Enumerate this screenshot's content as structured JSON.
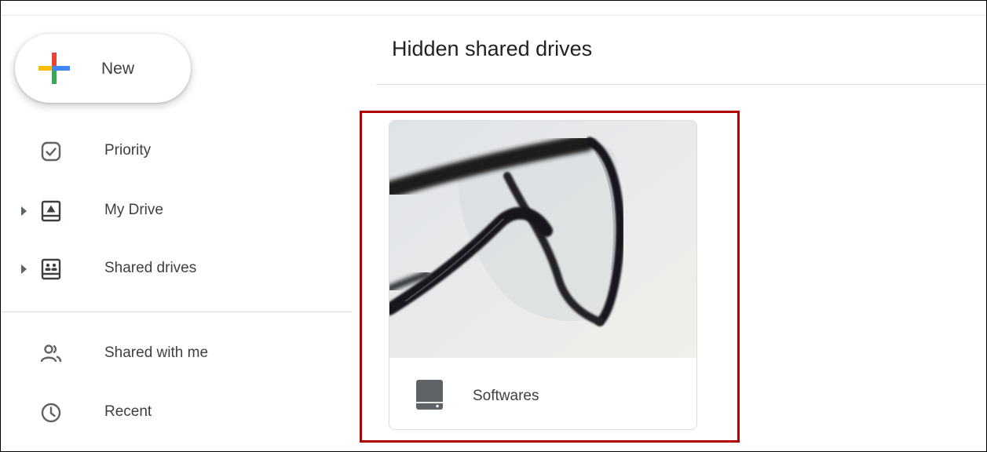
{
  "new_button": {
    "label": "New",
    "icon": "plus-icon",
    "colors": [
      "#ea4335",
      "#4285f4",
      "#34a853",
      "#fbbc04"
    ]
  },
  "sidebar": {
    "items": [
      {
        "label": "Priority",
        "icon": "priority-check-icon",
        "expandable": false
      },
      {
        "label": "My Drive",
        "icon": "my-drive-icon",
        "expandable": true
      },
      {
        "label": "Shared drives",
        "icon": "shared-drives-icon",
        "expandable": true
      },
      {
        "label": "Shared with me",
        "icon": "people-icon",
        "expandable": false
      },
      {
        "label": "Recent",
        "icon": "clock-icon",
        "expandable": false
      }
    ]
  },
  "main": {
    "title": "Hidden shared drives",
    "drives": [
      {
        "name": "Softwares",
        "thumbnail": "eyeglasses-photo",
        "icon": "shared-drive-icon"
      }
    ]
  },
  "colors": {
    "highlight": "#b00000",
    "text": "#3c4043",
    "icon": "#5f6368"
  }
}
